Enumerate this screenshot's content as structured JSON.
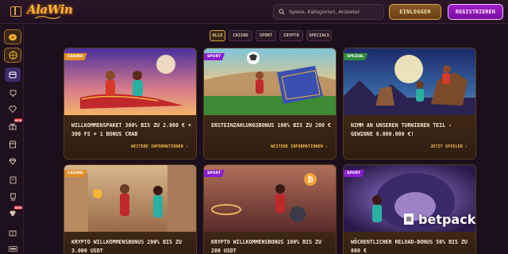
{
  "header": {
    "logo_text": "AlaWin",
    "search_placeholder": "Spiele, Kategorien, Anbieter",
    "login_label": "EINLOGGEN",
    "register_label": "REGISTRIEREN"
  },
  "sidebar": {
    "new_badge": "NEW",
    "items": [
      "casino-coin-icon",
      "sports-ball-icon",
      "promotions-icon",
      "trophy-icon",
      "diamond-icon",
      "gift-icon",
      "shop-icon",
      "vip-gem-icon",
      "document-icon",
      "cup-icon",
      "clover-icon",
      "book-icon",
      "live-icon"
    ]
  },
  "filters": [
    "ALLE",
    "CASINO",
    "SPORT",
    "CRYPTO",
    "SPECIALS"
  ],
  "cards": [
    {
      "tag": "CASINO",
      "title": "WILLKOMMENSPAKET 300% BIS ZU 2.000 € + 300 FS + 1 BONUS CRAB",
      "link": "WEITERE INFORMATIONEN"
    },
    {
      "tag": "SPORT",
      "title": "ERSTEINZAHLUNGSBONUS 100% BIS ZU 200 €",
      "link": "WEITERE INFORMATIONEN"
    },
    {
      "tag": "SPEZIAL",
      "title": "NIMM AN UNSEREN TURNIEREN TEIL - GEWINNE 6.000.000 €!",
      "link": "JETZT SPIELEN"
    },
    {
      "tag": "CASINO",
      "title": "KRYPTO WILLKOMMENSBONUS 200% BIS ZU 3.000 USDT",
      "link": ""
    },
    {
      "tag": "SPORT",
      "title": "KRYPTO WILLKOMMENSBONUS 100% BIS ZU 200 USDT",
      "link": ""
    },
    {
      "tag": "SPORT",
      "title": "WÖCHENTLICHER RELOAD-BONUS 50% BIS ZU 600 €",
      "link": ""
    }
  ],
  "watermark": "betpack",
  "colors": {
    "accent_gold": "#f0b84a",
    "register_purple": "#a11cc9",
    "casino_tag": "#e0902a",
    "sport_tag": "#8a1fd0",
    "special_tag": "#2f8a3a"
  }
}
